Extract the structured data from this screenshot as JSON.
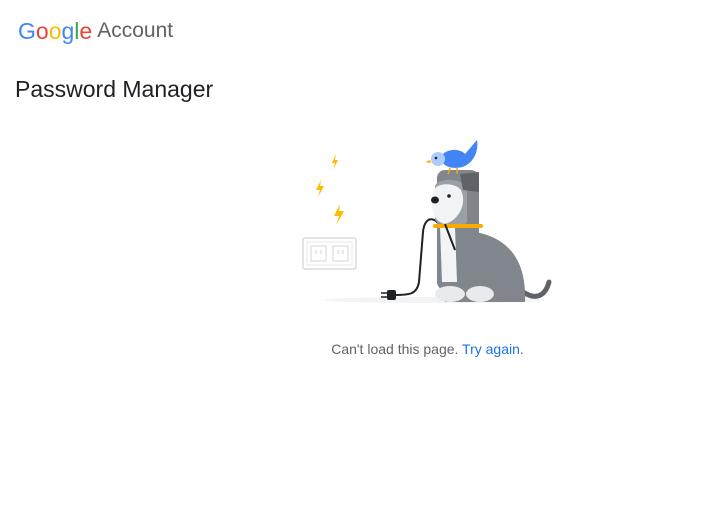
{
  "header": {
    "brand_letters": [
      "G",
      "o",
      "o",
      "g",
      "l",
      "e"
    ],
    "brand_colors": [
      "#4285F4",
      "#EA4335",
      "#FBBC05",
      "#4285F4",
      "#34A853",
      "#EA4335"
    ],
    "account_label": "Account"
  },
  "main": {
    "page_title": "Password Manager",
    "error_text": "Can't load this page.",
    "retry_link": "Try again",
    "retry_suffix": "."
  },
  "illustration": {
    "icons": [
      "lightning-bolt-icon",
      "power-outlet-icon",
      "dog-icon",
      "bird-icon",
      "plug-icon"
    ],
    "colors": {
      "bolt": "#FBBC04",
      "bird": "#4285F4",
      "dog": "#80868B",
      "collar": "#F9AB00"
    }
  }
}
